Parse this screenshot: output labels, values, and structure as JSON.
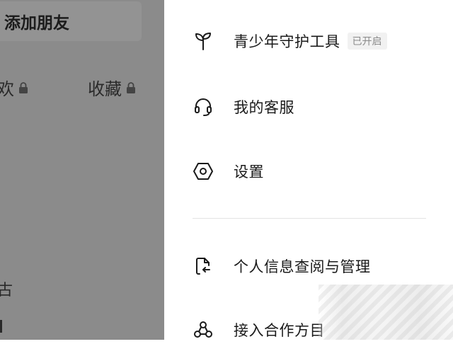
{
  "background": {
    "add_friend_label": "添加朋友",
    "tab_left_fragment": "欢",
    "tab_right_label": "收藏",
    "text_fragment": "古"
  },
  "drawer": {
    "items": [
      {
        "label": "青少年守护工具",
        "badge": "已开启",
        "icon": "sprout-icon"
      },
      {
        "label": "我的客服",
        "icon": "headset-icon"
      },
      {
        "label": "设置",
        "icon": "hexagon-settings-icon"
      },
      {
        "label": "个人信息查阅与管理",
        "icon": "document-arrow-icon"
      },
      {
        "label": "接入合作方目",
        "icon": "partner-network-icon"
      }
    ]
  },
  "colors": {
    "overlay": "#8b8b8b",
    "drawer_bg": "#ffffff",
    "text": "#1a1a1a",
    "badge_bg": "#f1f1f1",
    "badge_text": "#8a8a8a"
  }
}
